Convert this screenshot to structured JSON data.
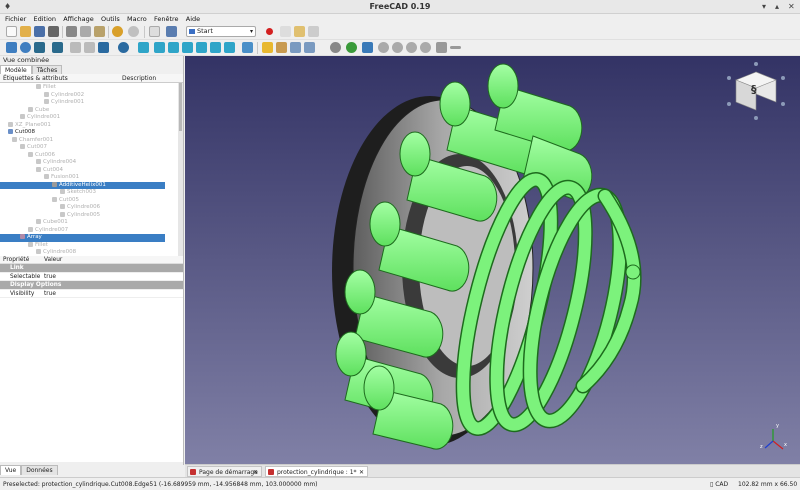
{
  "window": {
    "title": "FreeCAD 0.19",
    "menu_glyph": "♦"
  },
  "menu": [
    "Fichier",
    "Edition",
    "Affichage",
    "Outils",
    "Macro",
    "Fenêtre",
    "Aide"
  ],
  "toolbar": {
    "workbench": "Start"
  },
  "combo_view": {
    "title": "Vue combinée",
    "tabs": [
      "Modèle",
      "Tâches"
    ],
    "columns": [
      "Étiquettes & attributs",
      "Description"
    ]
  },
  "tree": [
    {
      "label": "Fillet",
      "indent": 9,
      "dim": true
    },
    {
      "label": "Cylindre002",
      "indent": 11,
      "dim": true
    },
    {
      "label": "Cylindre001",
      "indent": 11,
      "dim": true
    },
    {
      "label": "Cube",
      "indent": 7,
      "dim": true
    },
    {
      "label": "Cylindre001",
      "indent": 5,
      "dim": true
    },
    {
      "label": "XZ_Plane001",
      "indent": 2,
      "dim": true
    },
    {
      "label": "Cut008",
      "indent": 2,
      "dim": false
    },
    {
      "label": "Chamfer001",
      "indent": 3,
      "dim": true
    },
    {
      "label": "Cut007",
      "indent": 5,
      "dim": true
    },
    {
      "label": "Cut006",
      "indent": 7,
      "dim": true
    },
    {
      "label": "Cylindre004",
      "indent": 9,
      "dim": true
    },
    {
      "label": "Cut004",
      "indent": 9,
      "dim": true
    },
    {
      "label": "Fusion001",
      "indent": 11,
      "dim": true
    },
    {
      "label": "AdditiveHelix001",
      "indent": 13,
      "dim": false,
      "selected": true
    },
    {
      "label": "Sketch003",
      "indent": 15,
      "dim": true
    },
    {
      "label": "Cut005",
      "indent": 13,
      "dim": true
    },
    {
      "label": "Cylindre006",
      "indent": 15,
      "dim": true
    },
    {
      "label": "Cylindre005",
      "indent": 15,
      "dim": true
    },
    {
      "label": "Cube001",
      "indent": 9,
      "dim": true
    },
    {
      "label": "Cylindre007",
      "indent": 7,
      "dim": true
    },
    {
      "label": "Array",
      "indent": 5,
      "dim": false,
      "selected": true
    },
    {
      "label": "Fillet",
      "indent": 7,
      "dim": true
    },
    {
      "label": "Cylindre008",
      "indent": 9,
      "dim": true
    }
  ],
  "properties": {
    "columns": [
      "Propriété",
      "Valeur"
    ],
    "rows": [
      {
        "group": "Link"
      },
      {
        "key": "Selectable",
        "value": "true"
      },
      {
        "group": "Display Options"
      },
      {
        "key": "Visibility",
        "value": "true"
      }
    ]
  },
  "bottom_tabs": [
    "Vue",
    "Données"
  ],
  "doc_tabs": [
    {
      "label": "Page de démarrage",
      "active": false
    },
    {
      "label": "protection_cylindrique : 1*",
      "active": true
    }
  ],
  "navcube": {
    "face": "§"
  },
  "axis_labels": {
    "x": "x",
    "y": "y",
    "z": "z"
  },
  "status": {
    "message": "Preselected: protection_cylindrique.Cut008.Edge51 (-16.689959 mm, -14.956848 mm, 103.000000 mm)",
    "nav_style": "CAD",
    "dimensions": "102.82 mm x 66.50 mm"
  },
  "colors": {
    "viewport_top": "#333365",
    "viewport_bottom": "#8080a6",
    "selection": "#3a7ec4",
    "highlight_green": "#7cf27c"
  }
}
